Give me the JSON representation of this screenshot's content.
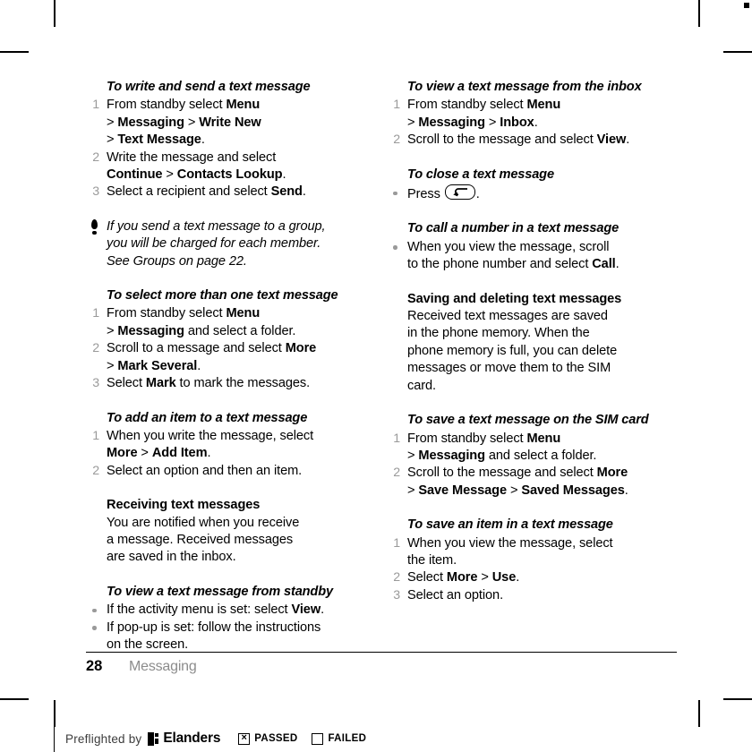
{
  "page": {
    "number": "28",
    "section": "Messaging"
  },
  "left_column": {
    "block1": {
      "heading": "To write and send a text message",
      "steps": [
        {
          "num": "1",
          "lines": [
            "From standby select <b>Menu</b>",
            "&gt; <b>Messaging</b> &gt; <b>Write New</b>",
            "&gt; <b>Text Message</b>."
          ]
        },
        {
          "num": "2",
          "lines": [
            "Write the message and select",
            "<b>Continue</b> &gt; <b>Contacts Lookup</b>."
          ]
        },
        {
          "num": "3",
          "lines": [
            "Select a recipient and select <b>Send</b>."
          ]
        }
      ]
    },
    "note": {
      "icon": "note-exclamation-icon",
      "lines": [
        "If you send a text message to a group,",
        "you will be charged for each member.",
        "See Groups on page 22."
      ]
    },
    "block2": {
      "heading": "To select more than one text message",
      "steps": [
        {
          "num": "1",
          "lines": [
            "From standby select <b>Menu</b>",
            "&gt; <b>Messaging</b> and select a folder."
          ]
        },
        {
          "num": "2",
          "lines": [
            "Scroll to a message and select <b>More</b>",
            "&gt; <b>Mark Several</b>."
          ]
        },
        {
          "num": "3",
          "lines": [
            "Select <b>Mark</b> to mark the messages."
          ]
        }
      ]
    },
    "block3": {
      "heading": "To add an item to a text message",
      "steps": [
        {
          "num": "1",
          "lines": [
            "When you write the message, select",
            "<b>More</b> &gt; <b>Add Item</b>."
          ]
        },
        {
          "num": "2",
          "lines": [
            "Select an option and then an item."
          ]
        }
      ]
    },
    "block4": {
      "heading": "Receiving text messages",
      "body": "You are notified when you receive<br>a message. Received messages<br>are saved in the inbox."
    },
    "block5": {
      "heading": "To view a text message from standby",
      "bullets": [
        {
          "lines": [
            "If the activity menu is set: select <b>View</b>."
          ]
        },
        {
          "lines": [
            "If pop-up is set: follow the instructions",
            "on the screen."
          ]
        }
      ]
    }
  },
  "right_column": {
    "block1": {
      "heading": "To view a text message from the inbox",
      "steps": [
        {
          "num": "1",
          "lines": [
            "From standby select <b>Menu</b>",
            "&gt; <b>Messaging</b> &gt; <b>Inbox</b>."
          ]
        },
        {
          "num": "2",
          "lines": [
            "Scroll to the message and select <b>View</b>."
          ]
        }
      ]
    },
    "block2": {
      "heading": "To close a text message",
      "bullet_prefix": "Press",
      "bullet_key_icon": "back-key-icon",
      "bullet_suffix": "."
    },
    "block3": {
      "heading": "To call a number in a text message",
      "bullets": [
        {
          "lines": [
            "When you view the message, scroll",
            "to the phone number and select <b>Call</b>."
          ]
        }
      ]
    },
    "block4": {
      "heading": "Saving and deleting text messages",
      "body": "Received text messages are saved<br>in the phone memory. When the<br>phone memory is full, you can delete<br>messages or move them to the SIM<br>card."
    },
    "block5": {
      "heading": "To save a text message on the SIM card",
      "steps": [
        {
          "num": "1",
          "lines": [
            "From standby select <b>Menu</b>",
            "&gt; <b>Messaging</b> and select a folder."
          ]
        },
        {
          "num": "2",
          "lines": [
            "Scroll to the message and select <b>More</b>",
            "&gt; <b>Save Message</b> &gt; <b>Saved Messages</b>."
          ]
        }
      ]
    },
    "block6": {
      "heading": "To save an item in a text message",
      "steps": [
        {
          "num": "1",
          "lines": [
            "When you view the message, select",
            "the item."
          ]
        },
        {
          "num": "2",
          "lines": [
            "Select <b>More</b> &gt; <b>Use</b>."
          ]
        },
        {
          "num": "3",
          "lines": [
            "Select an option."
          ]
        }
      ]
    }
  },
  "preflight": {
    "by_label": "Preflighted by",
    "brand": "Elanders",
    "logo_icon": "elanders-logo-icon",
    "passed_label": "PASSED",
    "passed_mark": "×",
    "passed_checked": true,
    "failed_label": "FAILED",
    "failed_checked": false
  },
  "colors": {
    "text": "#000000",
    "muted": "#9a9a9a",
    "footer_section": "#8c8c8c"
  }
}
